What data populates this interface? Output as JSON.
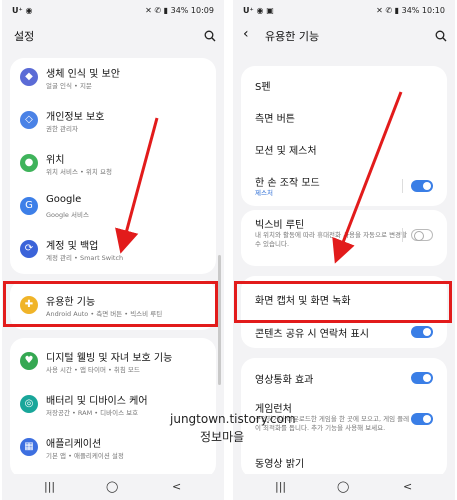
{
  "left": {
    "status": {
      "left": "U⁺ ◉",
      "right": "✕ ✆ ▮ 34% 10:09"
    },
    "title": "설정",
    "items": [
      {
        "title": "생체 인식 및 보안",
        "sub": "얼굴 인식 • 지문",
        "icon_color": "#5b6bd6",
        "icon": "shield-icon"
      },
      {
        "title": "개인정보 보호",
        "sub": "권한 관리자",
        "icon_color": "#4a82e6",
        "icon": "privacy-shield-icon"
      },
      {
        "title": "위치",
        "sub": "위치 서비스 • 위치 요청",
        "icon_color": "#3fb35b",
        "icon": "location-pin-icon"
      },
      {
        "title": "Google",
        "sub": "Google 서비스",
        "icon_color": "#3d7fe8",
        "icon": "google-icon"
      },
      {
        "title": "계정 및 백업",
        "sub": "계정 관리 • Smart Switch",
        "icon_color": "#3b63d9",
        "icon": "sync-icon"
      },
      {
        "title": "유용한 기능",
        "sub": "Android Auto • 측면 버튼 • 빅스비 루틴",
        "icon_color": "#f0b429",
        "icon": "gear-plus-icon"
      },
      {
        "title": "디지털 웰빙 및 자녀 보호 기능",
        "sub": "사용 시간 • 앱 타이머 • 취침 모드",
        "icon_color": "#35a852",
        "icon": "heart-icon"
      },
      {
        "title": "배터리 및 디바이스 케어",
        "sub": "저장공간 • RAM • 디바이스 보호",
        "icon_color": "#19a69a",
        "icon": "device-care-icon"
      },
      {
        "title": "애플리케이션",
        "sub": "기본 앱 • 애플리케이션 설정",
        "icon_color": "#3d6fe0",
        "icon": "apps-grid-icon"
      }
    ]
  },
  "right": {
    "status": {
      "left": "U⁺ ◉ ▣",
      "right": "✕ ✆ ▮ 34% 10:10"
    },
    "title": "유용한 기능",
    "items": [
      {
        "title": "S펜"
      },
      {
        "title": "측면 버튼"
      },
      {
        "title": "모션 및 제스처"
      },
      {
        "title": "한 손 조작 모드",
        "sub": "제스처",
        "toggle": true
      },
      {
        "title": "빅스비 루틴",
        "sub": "내 위치와 활동에 따라 휴대전화 사용을 자동으로 변경할 수 있습니다.",
        "toggle": false
      },
      {
        "title": "화면 캡처 및 화면 녹화"
      },
      {
        "title": "콘텐츠 공유 시 연락처 표시",
        "toggle": true
      },
      {
        "title": "영상통화 효과",
        "toggle": true
      },
      {
        "title": "게임런처",
        "sub": "구입하거나 다운로드한 게임을 한 곳에 모으고, 게임 플레이 최적화를 돕니다. 추가 기능을 사용해 보세요.",
        "toggle": true
      },
      {
        "title": "동영상 밝기"
      }
    ]
  },
  "watermark": {
    "line1": "jungtown.tistory.com",
    "line2": "정보마을"
  },
  "nav": {
    "recents": "|||",
    "home": "◯",
    "back": "<"
  }
}
